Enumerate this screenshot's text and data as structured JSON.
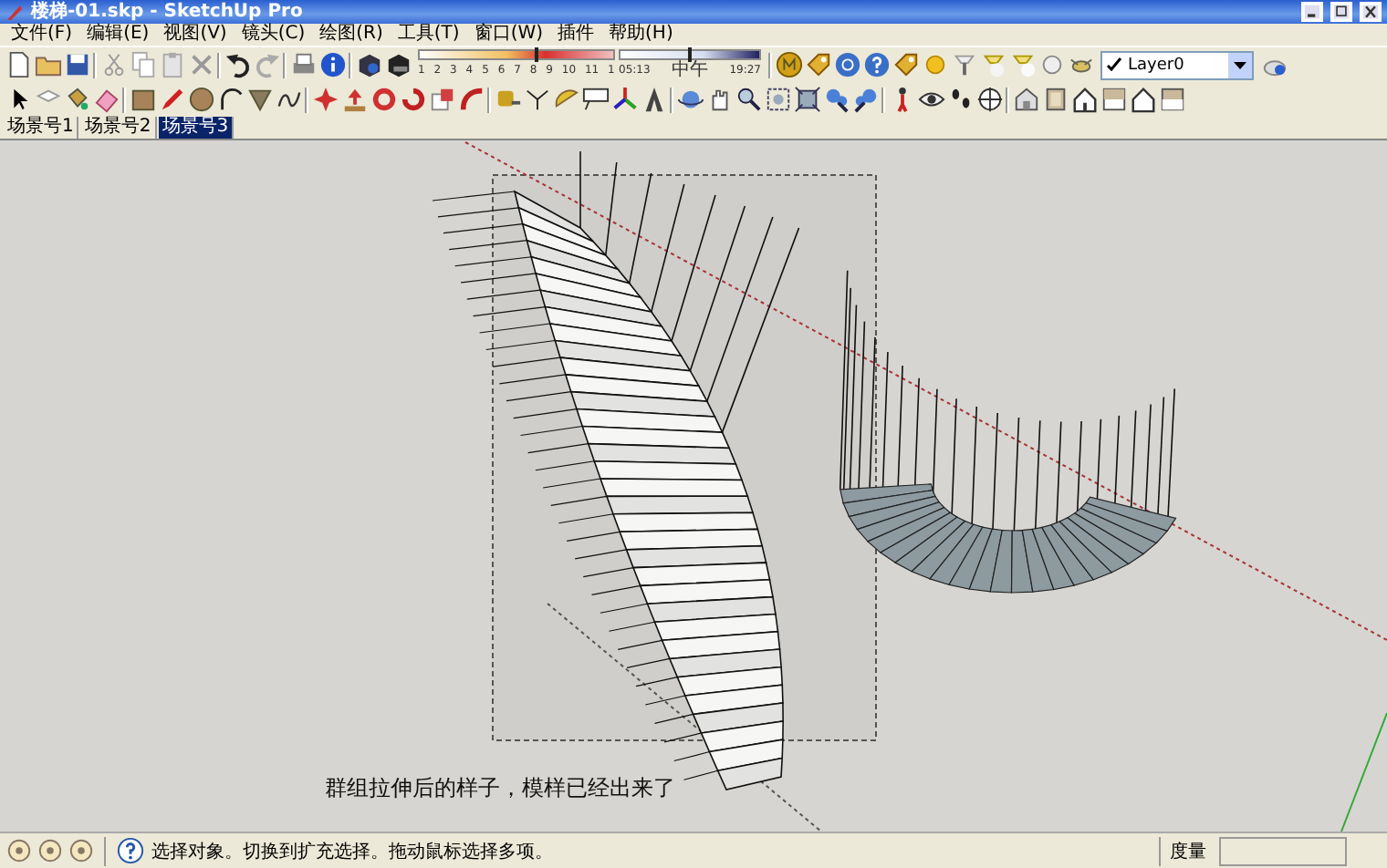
{
  "window": {
    "title": "楼梯-01.skp - SketchUp Pro"
  },
  "menu": [
    "文件(F)",
    "编辑(E)",
    "视图(V)",
    "镜头(C)",
    "绘图(R)",
    "工具(T)",
    "窗口(W)",
    "插件",
    "帮助(H)"
  ],
  "shadow_settings": {
    "month_slider": {
      "level": 0.6
    },
    "month_labels": [
      "1",
      "2",
      "3",
      "4",
      "5",
      "6",
      "7",
      "8",
      "9",
      "10",
      "11",
      "1"
    ],
    "time_slider": {
      "level": 0.5
    },
    "time_start": "05:13",
    "time_mid": "中午",
    "time_end": "19:27"
  },
  "layer": {
    "value": "Layer0",
    "checked": true
  },
  "scene_tabs": [
    {
      "label": "场景号1",
      "selected": false
    },
    {
      "label": "场景号2",
      "selected": false
    },
    {
      "label": "场景号3",
      "selected": true
    }
  ],
  "caption": "群组拉伸后的样子，模样已经出来了",
  "status_bar": {
    "message": "选择对象。切换到扩充选择。拖动鼠标选择多项。",
    "measurement_label": "度量"
  }
}
